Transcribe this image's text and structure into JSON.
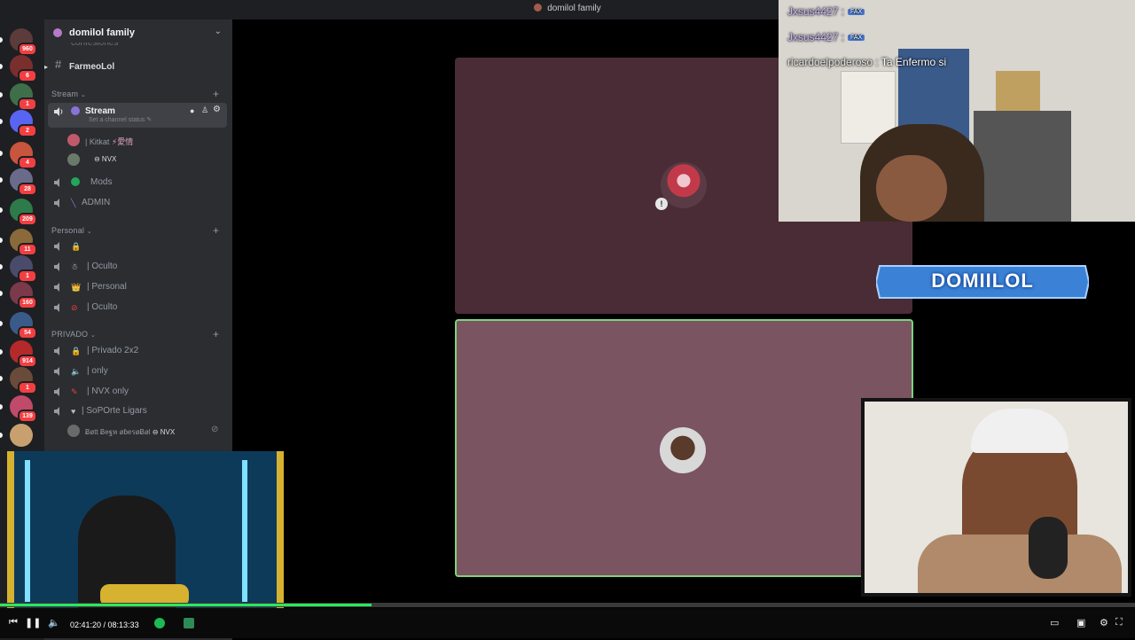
{
  "window": {
    "title": "domilol family"
  },
  "rail": {
    "servers": [
      {
        "badge": "960",
        "color": "#5c3b3b"
      },
      {
        "badge": "6",
        "color": "#7a2f2f"
      },
      {
        "badge": "1",
        "color": "#3f6e4a"
      },
      {
        "badge": "2",
        "color": "#5865f2"
      },
      {
        "badge": "4",
        "color": "#c8553d"
      },
      {
        "badge": "28",
        "color": "#6a6a8a"
      },
      {
        "badge": "209",
        "color": "#2f7a4a"
      },
      {
        "badge": "11",
        "color": "#8a6a3a"
      },
      {
        "badge": "1",
        "color": "#4a4a6a"
      },
      {
        "badge": "160",
        "color": "#7a3a4a"
      },
      {
        "badge": "54",
        "color": "#3a5a8a"
      },
      {
        "badge": "914",
        "color": "#b42a2a"
      },
      {
        "badge": "1",
        "color": "#6a4a3a"
      },
      {
        "badge": "139",
        "color": "#c04a6a"
      },
      {
        "badge": "",
        "color": "#c8a070"
      }
    ]
  },
  "server": {
    "name": "domilol family"
  },
  "channels": {
    "faded_top": "confesiones",
    "farmeo": "FarmeoLol",
    "cat_stream": "Stream",
    "stream": {
      "name": "Stream",
      "status": "Set a channel status"
    },
    "stream_users": [
      {
        "name": "| Kitkat",
        "tag": "⚡愛情"
      },
      {
        "name": "",
        "tag": "⊖ NVX"
      }
    ],
    "mods": "Mods",
    "admin": "ADMIN",
    "cat_personal": "Personal",
    "personal_items": [
      {
        "emoji": "🔒",
        "name": ""
      },
      {
        "emoji": "☃",
        "name": "| Oculto"
      },
      {
        "emoji": "👑",
        "name": "| Personal"
      },
      {
        "emoji": "⊘",
        "name": "| Oculto"
      }
    ],
    "cat_privado": "PRIVADO",
    "privado_items": [
      {
        "emoji": "🔒",
        "name": "| Privado 2x2"
      },
      {
        "emoji": "🔈",
        "name": "| only"
      },
      {
        "emoji": "✎",
        "name": "| NVX only"
      },
      {
        "emoji": "♥",
        "name": "| SoPOrte Ligars"
      }
    ],
    "bottom_user": {
      "name": "Ƀøtt Ƀeฐห øɓeรøɃøl",
      "tag": "⊖ NVX"
    }
  },
  "chat": [
    {
      "name": "Jxsus4427 :",
      "badge": "FAX",
      "msg": ""
    },
    {
      "name": "Jxsus4427 :",
      "badge": "FAX",
      "msg": ""
    },
    {
      "name": "ricardoelpoderoso :",
      "badge": "",
      "msg": "Ta Enfermo si"
    }
  ],
  "banner": "DOMIILOL",
  "player": {
    "time": "02:41:20 / 08:13:33",
    "progress_fraction": 0.327
  },
  "colors": {
    "tile_top": "#4a2c36",
    "tile_bottom": "#7a5460",
    "tile_border_active": "#7ed27e"
  }
}
